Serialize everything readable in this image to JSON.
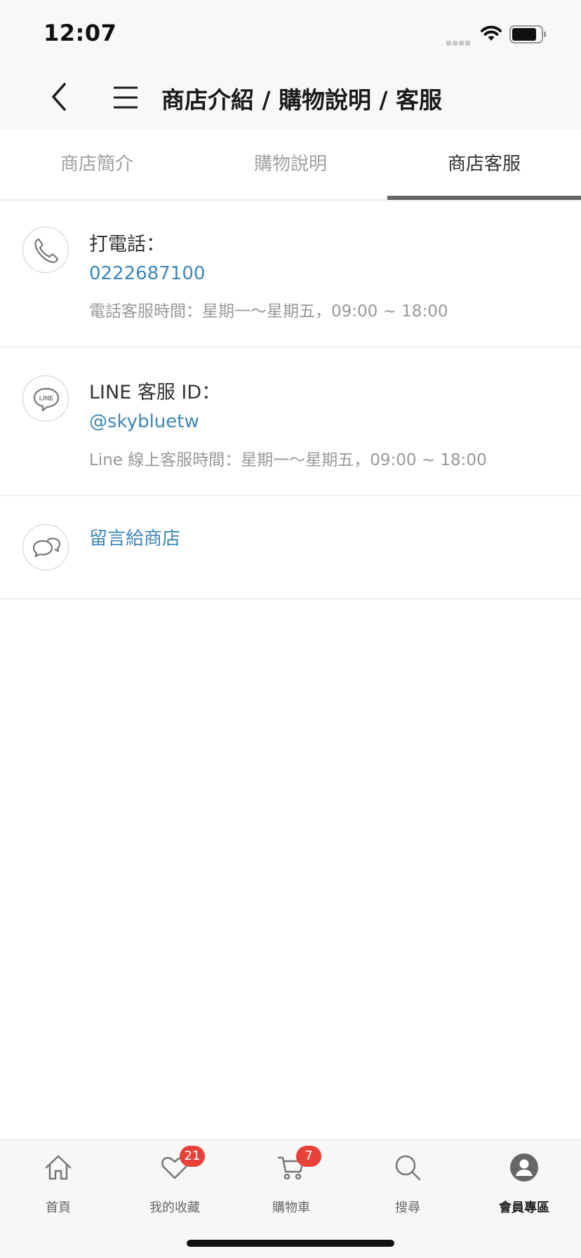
{
  "status_bar": {
    "time": "12:07"
  },
  "header": {
    "title": "商店介紹 / 購物說明 / 客服"
  },
  "tabs": [
    {
      "label": "商店簡介",
      "active": false
    },
    {
      "label": "購物說明",
      "active": false
    },
    {
      "label": "商店客服",
      "active": true
    }
  ],
  "contacts": {
    "phone": {
      "label": "打電話：",
      "value": "0222687100",
      "hours": "電話客服時間：星期一～星期五，09:00 ~ 18:00"
    },
    "line": {
      "label": "LINE 客服 ID：",
      "value": "@skybluetw",
      "hours": "Line 線上客服時間：星期一～星期五，09:00 ~ 18:00",
      "icon_text": "LINE"
    },
    "message": {
      "label": "留言給商店"
    }
  },
  "bottom_nav": [
    {
      "label": "首頁",
      "icon": "home-icon"
    },
    {
      "label": "我的收藏",
      "icon": "heart-icon",
      "badge": "21"
    },
    {
      "label": "購物車",
      "icon": "cart-icon",
      "badge": "7"
    },
    {
      "label": "搜尋",
      "icon": "search-icon"
    },
    {
      "label": "會員專區",
      "icon": "member-icon",
      "active": true
    }
  ],
  "colors": {
    "link": "#3d86b8",
    "badge": "#e8413a",
    "tab_indicator": "#666666"
  }
}
